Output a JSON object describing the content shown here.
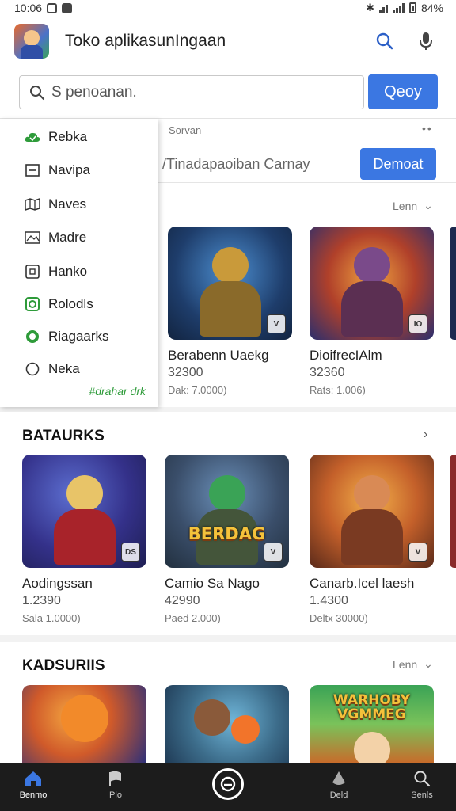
{
  "status_bar": {
    "time": "10:06",
    "battery": "84%"
  },
  "app": {
    "title": "Toko aplikasunIngaan"
  },
  "search": {
    "placeholder": "S penoanan.",
    "button_label": "Qeoy"
  },
  "top_section": {
    "suggest_label": "Sorvan",
    "banner_text": "/Tinadapaoiban Carnay",
    "banner_button": "Demoat",
    "more_label": "Lenn",
    "cards": [
      {
        "title": "Berabenn Uaekg",
        "count": "32300",
        "sub": "Dak: 7.0000)"
      },
      {
        "title": "DioifrecIAlm",
        "count": "32360",
        "sub": "Rats: 1.006)"
      }
    ]
  },
  "drawer": {
    "items": [
      {
        "label": "Rebka",
        "icon": "cloud-icon"
      },
      {
        "label": "Navipa",
        "icon": "window-icon"
      },
      {
        "label": "Naves",
        "icon": "map-icon"
      },
      {
        "label": "Madre",
        "icon": "image-icon"
      },
      {
        "label": "Hanko",
        "icon": "square-icon"
      },
      {
        "label": "Rolodls",
        "icon": "green-square-icon"
      },
      {
        "label": "Riagaarks",
        "icon": "green-circle-icon"
      },
      {
        "label": "Neka",
        "icon": "circle-icon"
      }
    ],
    "footer": "#drahar drk"
  },
  "section1": {
    "title": "BATAURKS",
    "cards": [
      {
        "title": "Aodingssan",
        "count": "1.2390",
        "sub": "Sala 1.0000)"
      },
      {
        "title": "Camio Sa Nago",
        "count": "42990",
        "sub": "Paed 2.000)",
        "logo": "BERDAG"
      },
      {
        "title": "Canarb.Icel laesh",
        "count": "1.4300",
        "sub": "Deltx 30000)"
      }
    ]
  },
  "section2": {
    "title": "KADSURIIS",
    "more_label": "Lenn",
    "cards": [
      {
        "title": ""
      },
      {
        "title": ""
      },
      {
        "title": "",
        "logo": "WARHOBY VGMMEG"
      }
    ]
  },
  "bottom_nav": {
    "items": [
      {
        "label": "Benmo",
        "icon": "home-icon",
        "active": true
      },
      {
        "label": "Plo",
        "icon": "flag-icon",
        "active": false
      },
      {
        "label": "",
        "icon": "center-circle-icon",
        "active": false
      },
      {
        "label": "Deld",
        "icon": "drop-icon",
        "active": false
      },
      {
        "label": "Senls",
        "icon": "search-icon",
        "active": false
      }
    ]
  },
  "colors": {
    "accent": "#3b77e2",
    "drawer_green": "#2e9b3a",
    "nav_bg": "#1c1c1c"
  }
}
